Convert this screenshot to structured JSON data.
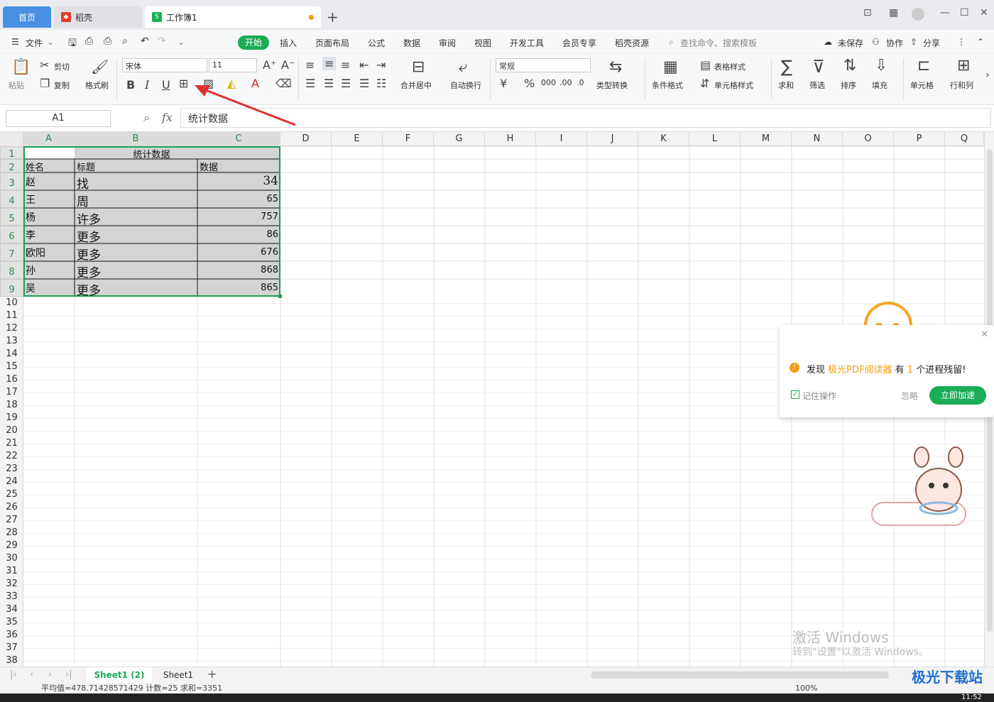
{
  "tabs": {
    "home": "首页",
    "wps": "稻壳",
    "book": "工作簿1"
  },
  "menu": {
    "file": "文件",
    "items": [
      "开始",
      "插入",
      "页面布局",
      "公式",
      "数据",
      "审阅",
      "视图",
      "开发工具",
      "会员专享",
      "稻壳资源"
    ],
    "search": "查找命令、搜索模板",
    "unsaved": "未保存",
    "collab": "协作",
    "share": "分享"
  },
  "ribbon": {
    "paste": "粘贴",
    "cut": "剪切",
    "copy": "复制",
    "format_painter": "格式刷",
    "font": "宋体",
    "size": "11",
    "merge": "合并居中",
    "wrap": "自动换行",
    "number_format": "常规",
    "type_convert": "类型转换",
    "cond_format": "条件格式",
    "table_style": "表格样式",
    "cell_style": "单元格样式",
    "sum": "求和",
    "filter": "筛选",
    "sort": "排序",
    "fill": "填充",
    "cell": "单元格",
    "rowcol": "行和列"
  },
  "formula": {
    "name_box": "A1",
    "fx": "fx",
    "content": "统计数据"
  },
  "columns": [
    "A",
    "B",
    "C",
    "D",
    "E",
    "F",
    "G",
    "H",
    "I",
    "J",
    "K",
    "L",
    "M",
    "N",
    "O",
    "P",
    "Q"
  ],
  "rows": [
    "1",
    "2",
    "3",
    "4",
    "5",
    "6",
    "7",
    "8",
    "9",
    "10",
    "11",
    "12",
    "13",
    "14",
    "15",
    "16",
    "17",
    "18",
    "19",
    "20",
    "21",
    "22",
    "23",
    "24",
    "25",
    "26",
    "27",
    "28",
    "29",
    "30",
    "31",
    "32",
    "33",
    "34",
    "35",
    "36",
    "37",
    "38"
  ],
  "table": {
    "title": "统计数据",
    "headers": [
      "姓名",
      "标题",
      "数据"
    ],
    "data": [
      [
        "赵",
        "找",
        "34"
      ],
      [
        "王",
        "周",
        "65"
      ],
      [
        "杨",
        "许多",
        "757"
      ],
      [
        "李",
        "更多",
        "86"
      ],
      [
        "欧阳",
        "更多",
        "676"
      ],
      [
        "孙",
        "更多",
        "868"
      ],
      [
        "吴",
        "更多",
        "865"
      ]
    ]
  },
  "sheets": {
    "active": "Sheet1 (2)",
    "other": "Sheet1"
  },
  "status": {
    "summary": "平均值=478.71428571429 计数=25 求和=3351",
    "zoom": "100%"
  },
  "popup": {
    "prefix": "发现",
    "app": "极光PDF阅读器",
    "middle": "有",
    "count": "1",
    "suffix": "个进程残留!",
    "remember": "记住操作",
    "ignore": "忽略",
    "speed": "立即加速"
  },
  "watermark": {
    "line1": "激活 Windows",
    "line2": "转到\"设置\"以激活 Windows。"
  },
  "site_logo": "极光下载站",
  "clock": "11:52",
  "colors": {
    "accent": "#1aad55",
    "selection": "#2d8a4b",
    "tab_home": "#4a90e2",
    "arrow": "#e03030"
  }
}
